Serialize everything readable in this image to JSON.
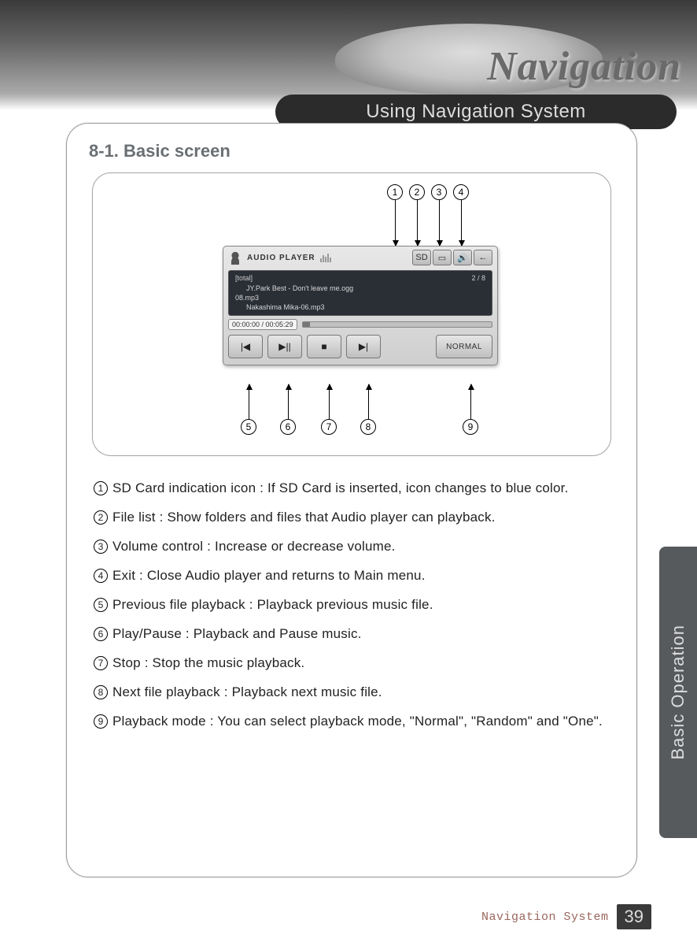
{
  "hero": {
    "brand_text": "Navigation"
  },
  "tab": {
    "title": "Using Navigation System"
  },
  "section": {
    "title": "8-1. Basic screen"
  },
  "player": {
    "title": "AUDIO PLAYER",
    "folder_label": "[total]",
    "counter": "2 / 8",
    "files": [
      "JY.Park Best - Don't leave me.ogg",
      "08.mp3",
      "Nakashima Mika-06.mp3"
    ],
    "time": "00:00:00 / 00:05:29",
    "mode_label": "NORMAL",
    "top_icons": {
      "sd": "SD",
      "filelist": "▭",
      "volume": "🔊",
      "exit": "←"
    },
    "ctrl_icons": {
      "prev": "|◀",
      "play_pause": "▶||",
      "stop": "■",
      "next": "▶|"
    }
  },
  "callouts": {
    "c1": "1",
    "c2": "2",
    "c3": "3",
    "c4": "4",
    "c5": "5",
    "c6": "6",
    "c7": "7",
    "c8": "8",
    "c9": "9"
  },
  "desc": [
    "SD Card indication icon : If SD Card is inserted, icon changes to blue color.",
    "File list : Show folders and files that Audio player can playback.",
    "Volume control : Increase or decrease volume.",
    "Exit : Close Audio player and returns to Main menu.",
    "Previous file playback : Playback previous music file.",
    "Play/Pause : Playback and Pause music.",
    "Stop : Stop the music playback.",
    "Next file playback : Playback next music file.",
    "Playback mode : You can select playback mode, \"Normal\", \"Random\" and \"One\"."
  ],
  "side_tab": {
    "label": "Basic Operation"
  },
  "footer": {
    "label": "Navigation System",
    "page": "39"
  }
}
